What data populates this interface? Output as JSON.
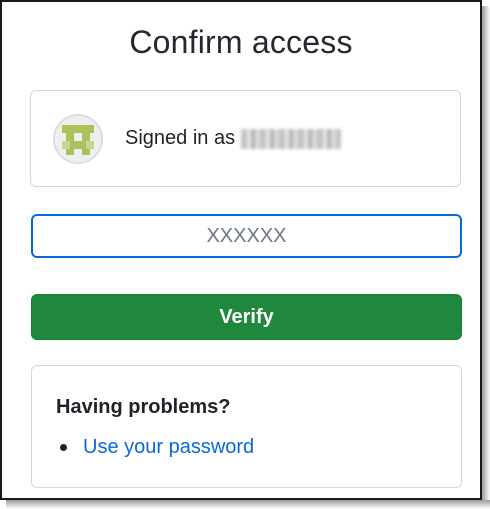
{
  "page": {
    "title": "Confirm access"
  },
  "account": {
    "signed_in_label": "Signed in as",
    "avatar_icon": "identicon-avatar"
  },
  "code_field": {
    "placeholder": "XXXXXX",
    "value": ""
  },
  "verify": {
    "label": "Verify"
  },
  "problems": {
    "heading": "Having problems?",
    "links": [
      "Use your password"
    ]
  },
  "colors": {
    "primary_button": "#1f883d",
    "link": "#0969da",
    "focus_border": "#0969da",
    "identicon": "#a9c25a"
  }
}
